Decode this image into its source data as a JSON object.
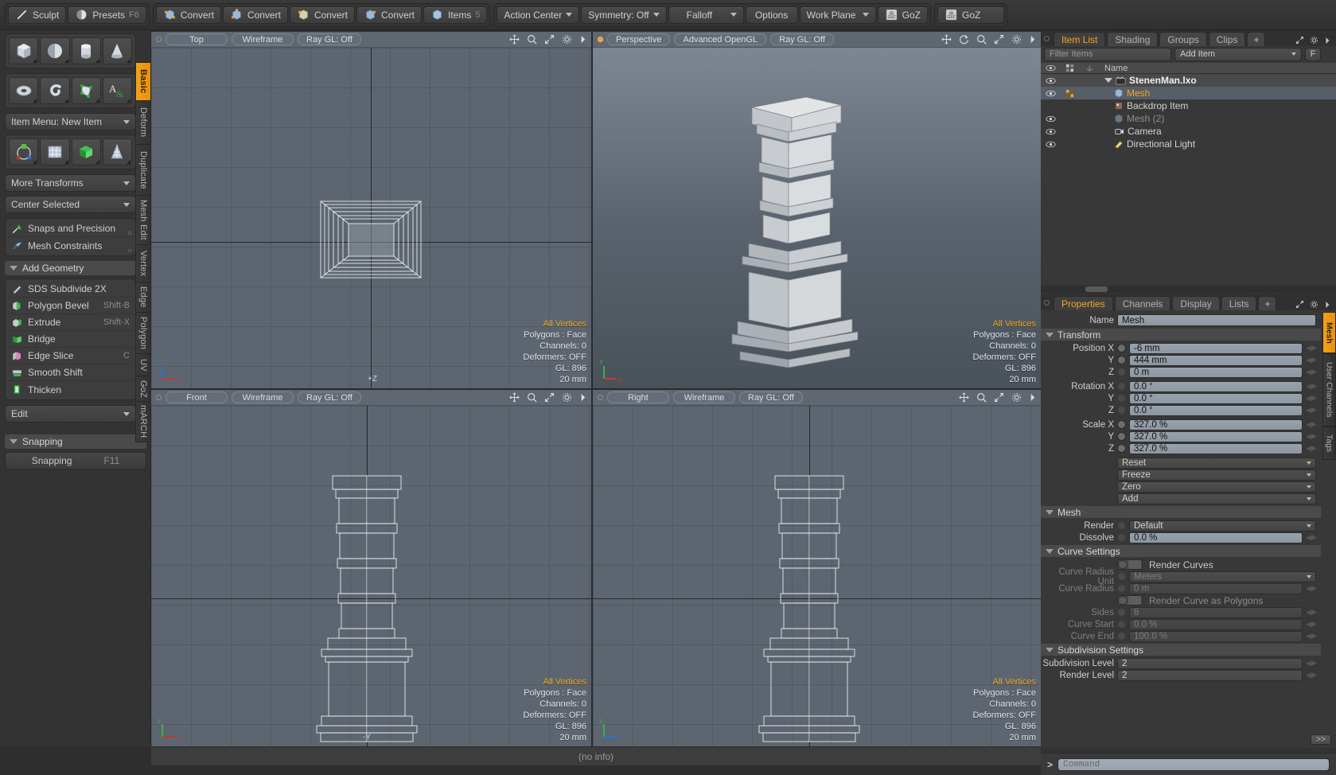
{
  "toolbar": {
    "groups": [
      {
        "items": [
          {
            "label": "Sculpt",
            "icon": "pencil-icon",
            "shortcut": ""
          },
          {
            "label": "Presets",
            "icon": "sphere-icon",
            "shortcut": "F6"
          }
        ]
      },
      {
        "items": [
          {
            "label": "Convert",
            "icon": "cube-blue-icon",
            "shortcut": ""
          },
          {
            "label": "Convert",
            "icon": "cube-blue-icon",
            "shortcut": ""
          },
          {
            "label": "Convert",
            "icon": "cube-tan-icon",
            "shortcut": ""
          },
          {
            "label": "Convert",
            "icon": "cube-blue-icon",
            "shortcut": ""
          },
          {
            "label": "Items",
            "icon": "cube-outline-icon",
            "shortcut": "5"
          }
        ]
      },
      {
        "items": [
          {
            "label": "Action Center",
            "icon": "",
            "shortcut": "",
            "dropdown": true
          },
          {
            "label": "Symmetry: Off",
            "icon": "",
            "shortcut": "",
            "dropdown": true
          },
          {
            "label": "Falloff",
            "icon": "",
            "shortcut": "",
            "dropdown": true
          },
          {
            "label": "Options",
            "icon": "",
            "shortcut": ""
          },
          {
            "label": "Work Plane",
            "icon": "",
            "shortcut": "",
            "dropdown": true
          },
          {
            "label": "GoZ",
            "icon": "goz-icon",
            "shortcut": ""
          }
        ]
      },
      {
        "items": [
          {
            "label": "GoZ",
            "icon": "goz-icon",
            "shortcut": ""
          }
        ]
      }
    ]
  },
  "left_panel": {
    "primitive_icons_row1": [
      "cube-icon",
      "sphere-icon",
      "cylinder-icon",
      "cone-icon"
    ],
    "primitive_icons_row2": [
      "torus-icon",
      "spiral-icon",
      "polygon-icon",
      "text-icon"
    ],
    "item_menu": "Item Menu: New Item",
    "transform_icons": [
      "transform-gizmo-icon",
      "grid-plane-icon",
      "green-mesh-icon",
      "lattice-icon"
    ],
    "more_transforms": "More Transforms",
    "center_selected": "Center Selected",
    "snaps_and_precision": "Snaps and Precision",
    "mesh_constraints": "Mesh Constraints",
    "add_geometry_header": "Add Geometry",
    "geometry_tools": [
      {
        "label": "SDS Subdivide 2X",
        "shortcut": "",
        "icon": "subdivide-icon"
      },
      {
        "label": "Polygon Bevel",
        "shortcut": "Shift-B",
        "icon": "bevel-icon"
      },
      {
        "label": "Extrude",
        "shortcut": "Shift-X",
        "icon": "extrude-icon"
      },
      {
        "label": "Bridge",
        "shortcut": "",
        "icon": "bridge-icon"
      },
      {
        "label": "Edge Slice",
        "shortcut": "C",
        "icon": "slice-icon"
      },
      {
        "label": "Smooth Shift",
        "shortcut": "",
        "icon": "smooth-shift-icon"
      },
      {
        "label": "Thicken",
        "shortcut": "",
        "icon": "thicken-icon"
      }
    ],
    "edit_dropdown": "Edit",
    "snapping_header": "Snapping",
    "snapping_label": "Snapping",
    "snapping_shortcut": "F11",
    "vertical_tabs": [
      "Basic",
      "Deform",
      "Duplicate",
      "Mesh Edit",
      "Vertex",
      "Edge",
      "Polygon",
      "UV",
      "GoZ",
      "mARCH"
    ],
    "active_vertical_tab": "Basic"
  },
  "viewports": [
    {
      "name": "top-view",
      "view_label": "Top",
      "shading_label": "Wireframe",
      "ray_label": "Ray GL: Off",
      "icons": [
        "move-icon",
        "zoom-icon",
        "fit-icon",
        "gear-icon",
        "arrow-icon"
      ],
      "info": {
        "selection": "All Vertices",
        "polygons": "Polygons : Face",
        "channels": "Channels: 0",
        "deformers": "Deformers: OFF",
        "gl": "GL: 896",
        "scale": "20 mm"
      },
      "axis_labels": [
        "+Z",
        "+X"
      ]
    },
    {
      "name": "perspective-view",
      "view_label": "Perspective",
      "shading_label": "Advanced OpenGL",
      "ray_label": "Ray GL: Off",
      "icons": [
        "move-icon",
        "rotate-icon",
        "zoom-icon",
        "fit-icon",
        "gear-icon",
        "arrow-icon"
      ],
      "info": {
        "selection": "All Vertices",
        "polygons": "Polygons : Face",
        "channels": "Channels: 0",
        "deformers": "Deformers: OFF",
        "gl": "GL: 896",
        "scale": "20 mm"
      },
      "axis_labels": [
        "Y",
        "X"
      ]
    },
    {
      "name": "front-view",
      "view_label": "Front",
      "shading_label": "Wireframe",
      "ray_label": "Ray GL: Off",
      "icons": [
        "move-icon",
        "zoom-icon",
        "fit-icon",
        "gear-icon",
        "arrow-icon"
      ],
      "info": {
        "selection": "All Vertices",
        "polygons": "Polygons : Face",
        "channels": "Channels: 0",
        "deformers": "Deformers: OFF",
        "gl": "GL: 896",
        "scale": "20 mm"
      },
      "axis_labels": [
        "-Y",
        "-X"
      ]
    },
    {
      "name": "right-view",
      "view_label": "Right",
      "shading_label": "Wireframe",
      "ray_label": "Ray GL: Off",
      "icons": [
        "move-icon",
        "zoom-icon",
        "fit-icon",
        "gear-icon",
        "arrow-icon"
      ],
      "info": {
        "selection": "All Vertices",
        "polygons": "Polygons : Face",
        "channels": "Channels: 0",
        "deformers": "Deformers: OFF",
        "gl": "GL: 896",
        "scale": "20 mm"
      },
      "axis_labels": [
        "Y",
        "+Z"
      ]
    }
  ],
  "status_bar": {
    "text": "(no info)"
  },
  "item_list": {
    "tabs": [
      "Item List",
      "Shading",
      "Groups",
      "Clips"
    ],
    "active_tab": "Item List",
    "add_tab_label": "+",
    "filter_placeholder": "Filter Items",
    "add_item_label": "Add Item",
    "filter_button_label": "F",
    "column_header_name": "Name",
    "rows": [
      {
        "name": "StenenMan.lxo",
        "icon": "scene-icon",
        "indent": 0,
        "visible": true,
        "selected": false,
        "is_scene": true,
        "dimmed": false,
        "expanded": true
      },
      {
        "name": "Mesh",
        "icon": "mesh-icon",
        "indent": 1,
        "visible": true,
        "selected": true,
        "is_scene": false,
        "dimmed": false
      },
      {
        "name": "Backdrop Item",
        "icon": "backdrop-icon",
        "indent": 1,
        "visible": false,
        "selected": false,
        "is_scene": false,
        "dimmed": false
      },
      {
        "name": "Mesh (2)",
        "icon": "mesh-icon",
        "indent": 1,
        "visible": true,
        "selected": false,
        "is_scene": false,
        "dimmed": true
      },
      {
        "name": "Camera",
        "icon": "camera-icon",
        "indent": 1,
        "visible": true,
        "selected": false,
        "is_scene": false,
        "dimmed": false
      },
      {
        "name": "Directional Light",
        "icon": "light-icon",
        "indent": 1,
        "visible": true,
        "selected": false,
        "is_scene": false,
        "dimmed": false
      }
    ]
  },
  "properties": {
    "tabs": [
      "Properties",
      "Channels",
      "Display",
      "Lists"
    ],
    "active_tab": "Properties",
    "add_tab_label": "+",
    "name_label": "Name",
    "name_value": "Mesh",
    "transform_header": "Transform",
    "transform_rows": [
      {
        "label": "Position X",
        "value": "-6 mm",
        "enabled": true
      },
      {
        "label": "Y",
        "value": "444 mm",
        "enabled": true
      },
      {
        "label": "Z",
        "value": "0 m",
        "enabled": false
      },
      {
        "label": "Rotation X",
        "value": "0.0 °",
        "enabled": false
      },
      {
        "label": "Y",
        "value": "0.0 °",
        "enabled": false
      },
      {
        "label": "Z",
        "value": "0.0 °",
        "enabled": false
      },
      {
        "label": "Scale X",
        "value": "327.0 %",
        "enabled": true
      },
      {
        "label": "Y",
        "value": "327.0 %",
        "enabled": true
      },
      {
        "label": "Z",
        "value": "327.0 %",
        "enabled": true
      }
    ],
    "transform_menus": [
      "Reset",
      "Freeze",
      "Zero",
      "Add"
    ],
    "mesh_header": "Mesh",
    "mesh_rows": [
      {
        "label": "Render",
        "value": "Default",
        "type": "dropdown",
        "enabled": false
      },
      {
        "label": "Dissolve",
        "value": "0.0 %",
        "type": "value",
        "enabled": true
      }
    ],
    "curve_header": "Curve Settings",
    "render_curves_label": "Render Curves",
    "curve_rows": [
      {
        "label": "Curve Radius Unit",
        "value": "Meters",
        "type": "dropdown",
        "enabled": false
      },
      {
        "label": "Curve Radius",
        "value": "0 m",
        "type": "value",
        "enabled": false
      },
      {
        "label": "Sides",
        "value": "8",
        "type": "value",
        "enabled": false
      },
      {
        "label": "Curve Start",
        "value": "0.0 %",
        "type": "value",
        "enabled": false
      },
      {
        "label": "Curve End",
        "value": "100.0 %",
        "type": "value",
        "enabled": false
      }
    ],
    "render_curve_as_polygons_label": "Render Curve as Polygons",
    "subdivision_header": "Subdivision Settings",
    "subdivision_rows": [
      {
        "label": "Subdivision Level",
        "value": "2",
        "enabled": true
      },
      {
        "label": "Render Level",
        "value": "2",
        "enabled": true
      }
    ],
    "expand_button_label": ">>",
    "vertical_tabs": [
      "Mesh",
      "User Channels",
      "Tags"
    ],
    "active_vertical_tab": "Mesh"
  },
  "command_bar": {
    "prompt": ">",
    "placeholder": "Command",
    "value": ""
  },
  "colors": {
    "accent": "#f5a623",
    "panel": "#383838",
    "viewport_bg": "#5d6670",
    "selection": "#565e68",
    "field": "#99a3ad"
  }
}
